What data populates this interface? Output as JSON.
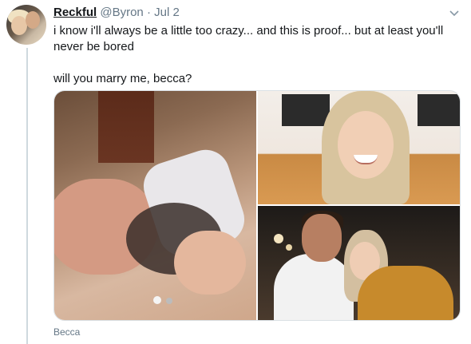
{
  "tweet": {
    "display_name": "Reckful",
    "handle": "@Byron",
    "separator": "·",
    "date": "Jul 2",
    "text_line1": "i know i'll always be a little too crazy... and this is proof... but at least you'll never be bored",
    "text_line2": "will you marry me, becca?",
    "media_caption": "Becca"
  },
  "icons": {
    "menu": "chevron-down-icon"
  },
  "colors": {
    "secondary_text": "#657786",
    "primary_text": "#14171a",
    "thread_line": "#cfd9de"
  }
}
